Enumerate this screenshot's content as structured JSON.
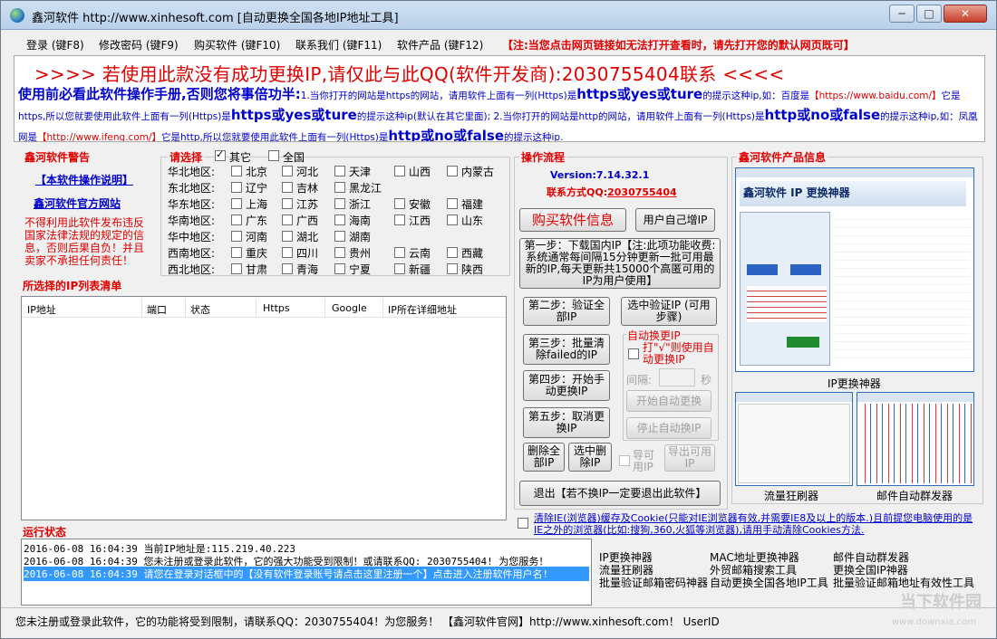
{
  "window": {
    "title": "鑫河软件 http://www.xinhesoft.com [自动更换全国各地IP地址工具]",
    "min": "─",
    "max": "□",
    "close": "✕"
  },
  "menu": {
    "items": [
      "登录 (键F8)",
      "修改密码 (键F9)",
      "购买软件 (键F10)",
      "联系我们 (键F11)",
      "软件产品 (键F12)"
    ],
    "warning": "【注:当您点击网页链接如无法打开查看时，请先打开您的默认网页既可】"
  },
  "banner": {
    "headline": ">>>>    若使用此款没有成功更换IP,请仅此与此QQ(软件开发商):2030755404联系  <<<<",
    "lead": "使用前必看此软件操作手册,否则您将事倍功半:",
    "p1": "1.当你打开的网站是https的网站，请用软件上面有一列(Https)是",
    "k1": "https或yes或ture",
    "p2": "的提示这种ip,如：百度是",
    "url1": "【https://www.baidu.com/】",
    "p3": "它是https,所以您就要使用此软件上面有一列(Https)是",
    "k2": "https或yes或ture",
    "p4": "的提示这种ip(默认在其它里面); 2.当你打开的网站是http的网站，请用软件上面有一列(Https)是",
    "k3": "http或no或false",
    "p5": "的提示这种ip,如：凤凰网是",
    "url2": "【http://www.ifeng.com/】",
    "p6": "它是http,所以您就要使用此软件上面有一列(Https)是",
    "k4": "http或no或false",
    "p7": "的提示这种ip."
  },
  "warning_panel": {
    "title": "鑫河软件警告",
    "link_manual": "【本软件操作说明】",
    "link_site": "鑫河软件官方网站",
    "text": "不得利用此软件发布违反国家法律法规的规定的信息，否则后果自负！并且卖家不承担任何责任！"
  },
  "region": {
    "title": "请选择",
    "other": "其它",
    "nationwide": "全国",
    "rows": [
      {
        "label": "华北地区:",
        "items": [
          "北京",
          "河北",
          "天津",
          "山西",
          "内蒙古"
        ]
      },
      {
        "label": "东北地区:",
        "items": [
          "辽宁",
          "吉林",
          "黑龙江"
        ]
      },
      {
        "label": "华东地区:",
        "items": [
          "上海",
          "江苏",
          "浙江",
          "安徽",
          "福建"
        ]
      },
      {
        "label": "华南地区:",
        "items": [
          "广东",
          "广西",
          "海南",
          "江西",
          "山东"
        ]
      },
      {
        "label": "华中地区:",
        "items": [
          "河南",
          "湖北",
          "湖南"
        ]
      },
      {
        "label": "西南地区:",
        "items": [
          "重庆",
          "四川",
          "贵州",
          "云南",
          "西藏"
        ]
      },
      {
        "label": "西北地区:",
        "items": [
          "甘肃",
          "青海",
          "宁夏",
          "新疆",
          "陕西"
        ]
      }
    ]
  },
  "iplist": {
    "title": "所选择的IP列表清单",
    "columns": [
      "IP地址",
      "端口",
      "状态",
      "Https",
      "Google",
      "IP所在详细地址"
    ]
  },
  "ops": {
    "title": "操作流程",
    "version": "Version:7.14.32.1",
    "contact_label": "联系方式QQ:",
    "contact_qq": "2030755404",
    "buy": "购买软件信息",
    "user_add_ip": "用户自己增IP",
    "step1": "第一步：下载国内IP【注:此项功能收费:系统通常每间隔15分钟更新一批可用最新的IP,每天更新共15000个高匿可用的IP为用户使用】",
    "step2": "第二步：验证全部IP",
    "verify_selected": "选中验证IP (可用步骤)",
    "step3": "第三步：批量清除failed的IP",
    "step4": "第四步：开始手动更换IP",
    "step5": "第五步：取消更换IP",
    "delete_all": "删除全部IP",
    "delete_selected": "选中删除IP",
    "export_ip": "导出可用IP",
    "export_label": "导可用IP",
    "exit": "退出【若不换IP一定要退出此软件】",
    "auto_title": "自动换更IP",
    "auto_check": "打\"√\"则使用自动更换IP",
    "interval_label": "间隔:",
    "interval_unit": "秒",
    "start_auto": "开始自动更换",
    "stop_auto": "停止自动换IP"
  },
  "products": {
    "title": "鑫河软件产品信息",
    "main_caption": "IP更换神器",
    "main_img_title": "鑫河软件 IP 更换神器",
    "cap2": "流量狂刷器",
    "cap3": "邮件自动群发器"
  },
  "status": {
    "title": "运行状态",
    "logs": [
      {
        "time": "2016-06-08 16:04:39",
        "msg": "当前IP地址是:115.219.40.223"
      },
      {
        "time": "2016-06-08 16:04:39",
        "msg": "您未注册或登录此软件，它的强大功能受到限制！或请联系QQ: 2030755404! 为您服务！"
      },
      {
        "time": "2016-06-08 16:04:39",
        "msg": "请您在登录对话框中的【没有软件登录账号请点击这里注册一个】点击进入注册软件用户名!"
      }
    ]
  },
  "clear": {
    "text": "清除IE(浏览器)缓存及Cookie(只能对IE浏览器有效,并需要IE8及以上的版本.)且前提您电脑使用的是IE之外的浏览器(比如:搜狗,360,火狐等浏览器),请用手动清除Cookies方法."
  },
  "product_links": [
    "IP更换神器",
    "MAC地址更换神器",
    "邮件自动群发器",
    "流量狂刷器",
    "外贸邮箱搜索工具",
    "更换全国IP神器",
    "批量验证邮箱密码神器",
    "自动更换全国各地IP工具",
    "批量验证邮箱地址有效性工具"
  ],
  "statusbar": {
    "text": "您未注册或登录此软件，它的功能将受到限制，请联系QQ：2030755404！为您服务！ 【鑫河软件官网】http://www.xinhesoft.com！   UserID"
  },
  "watermark": {
    "name": "当下软件园",
    "url": "www.downxia.com"
  },
  "colors": {
    "red": "#e00000",
    "blue": "#0000cc",
    "selection": "#3399ff"
  }
}
